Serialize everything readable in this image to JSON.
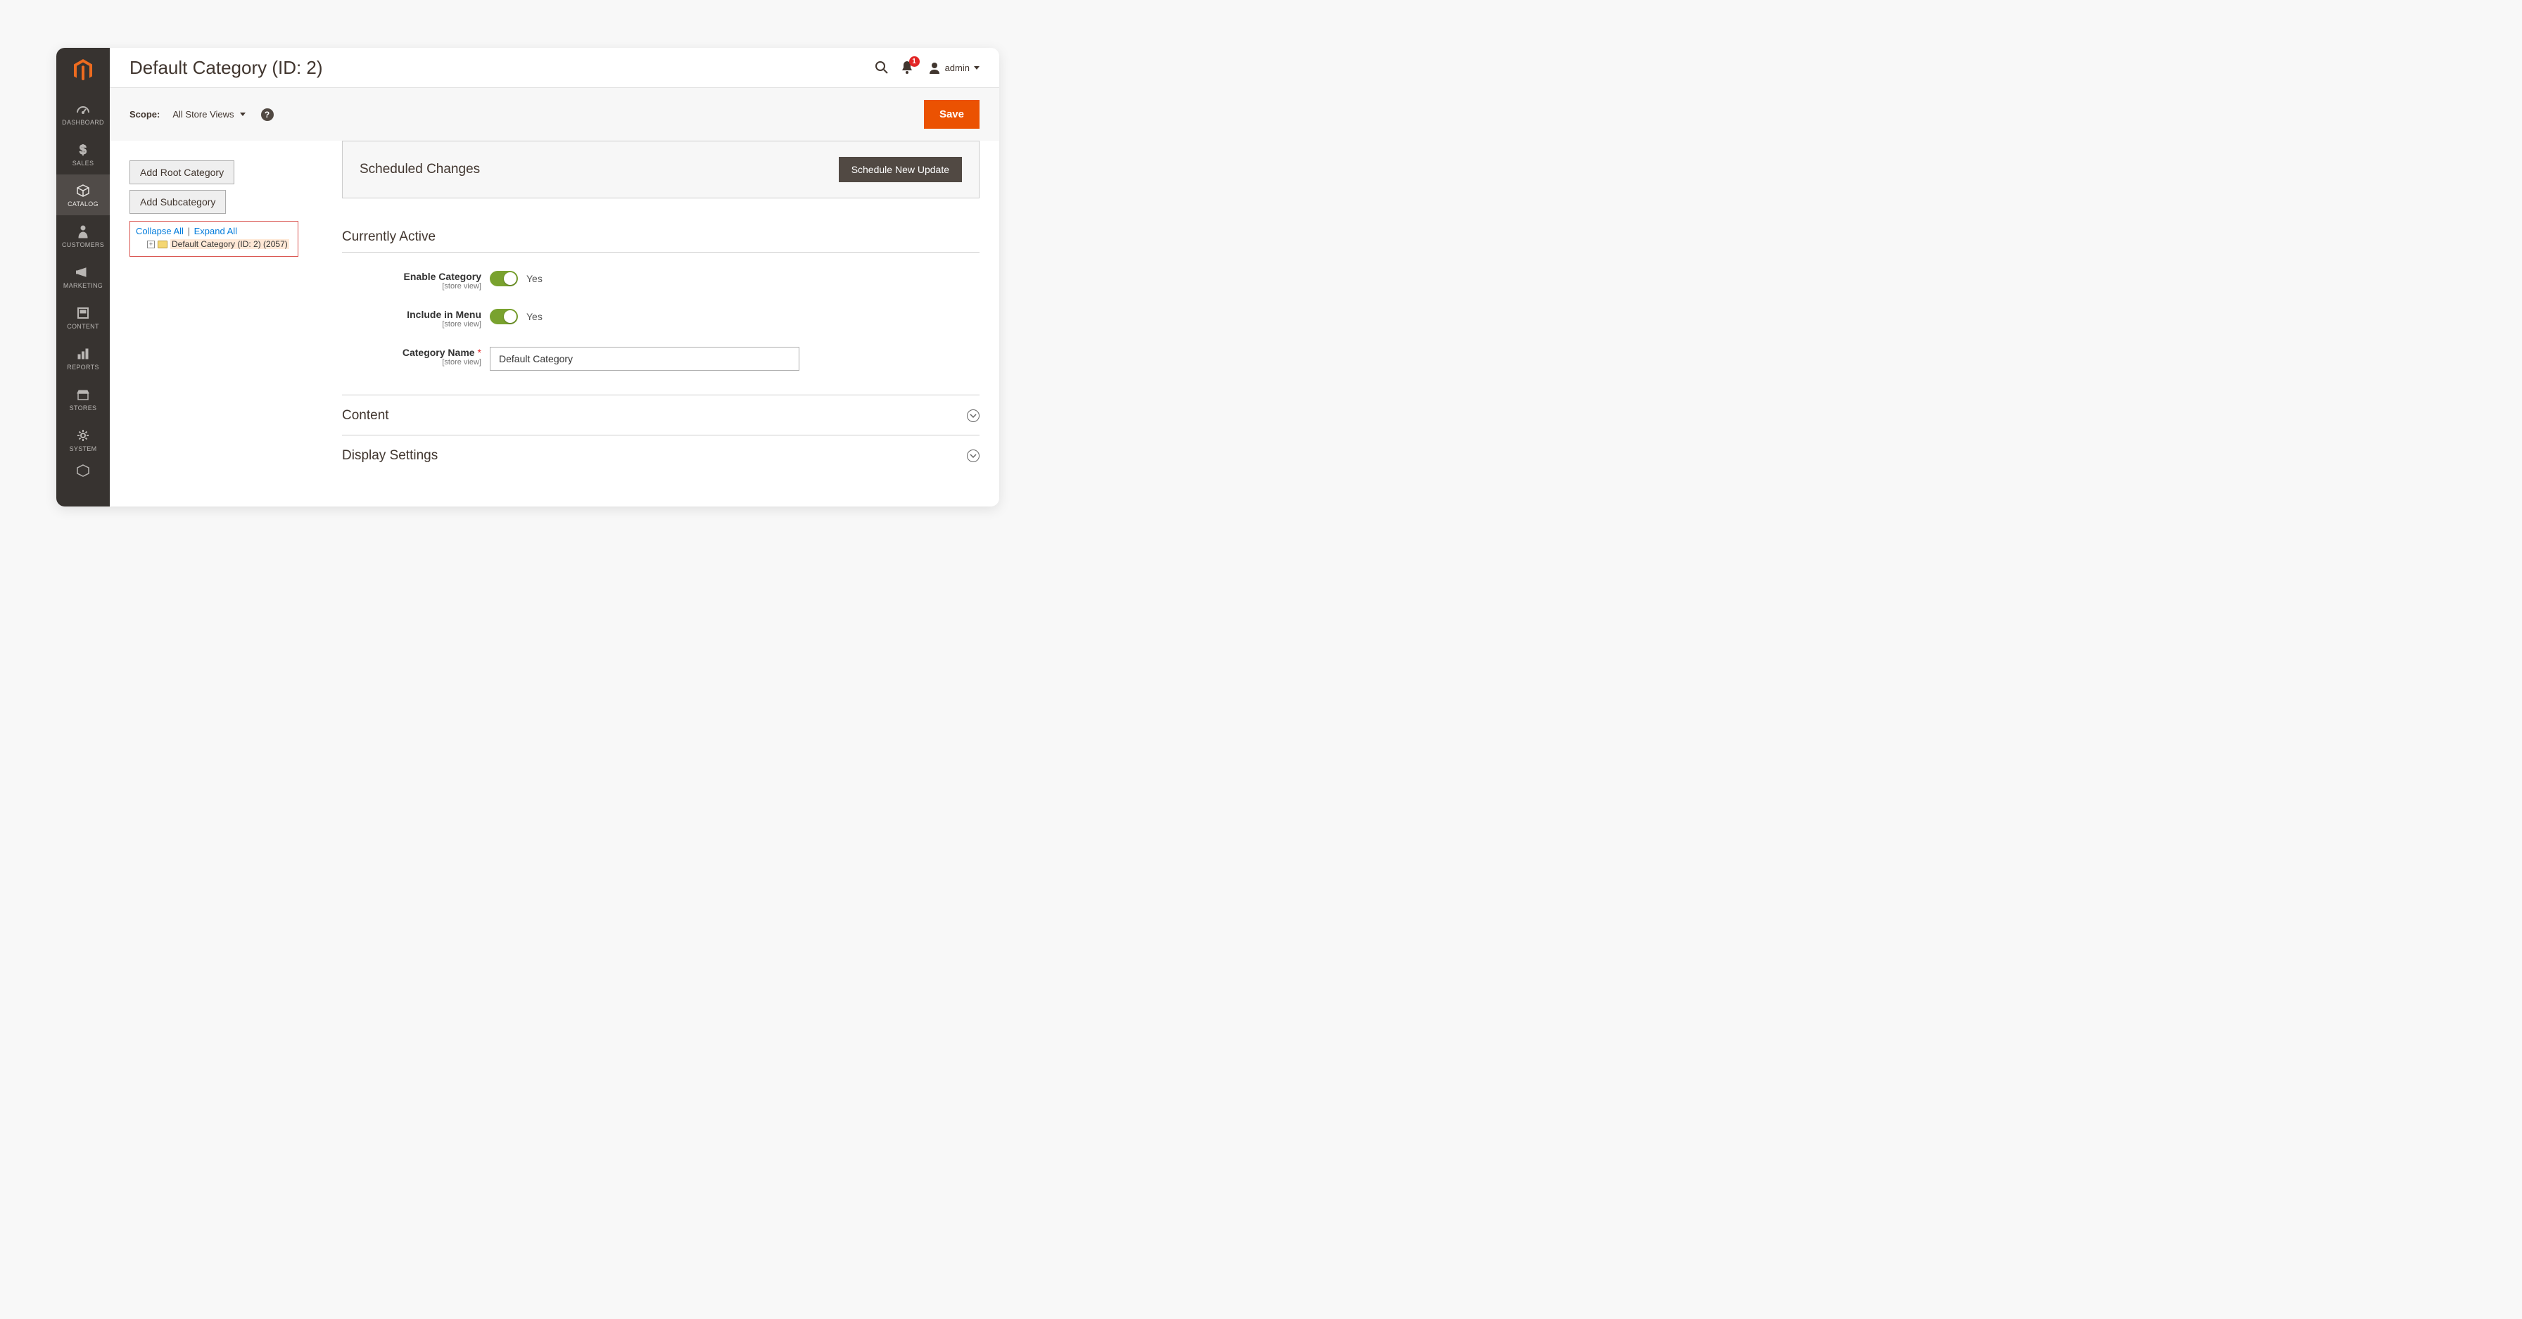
{
  "sidebar": {
    "items": [
      {
        "label": "DASHBOARD"
      },
      {
        "label": "SALES"
      },
      {
        "label": "CATALOG"
      },
      {
        "label": "CUSTOMERS"
      },
      {
        "label": "MARKETING"
      },
      {
        "label": "CONTENT"
      },
      {
        "label": "REPORTS"
      },
      {
        "label": "STORES"
      },
      {
        "label": "SYSTEM"
      }
    ]
  },
  "header": {
    "title": "Default Category (ID: 2)",
    "notification_count": "1",
    "user": "admin"
  },
  "scope": {
    "label": "Scope:",
    "value": "All Store Views",
    "save": "Save"
  },
  "tree": {
    "add_root": "Add Root Category",
    "add_sub": "Add Subcategory",
    "collapse": "Collapse All",
    "expand": "Expand All",
    "node": "Default Category (ID: 2) (2057)"
  },
  "scheduled": {
    "title": "Scheduled Changes",
    "button": "Schedule New Update"
  },
  "section_active": "Currently Active",
  "fields": {
    "enable": {
      "label": "Enable Category",
      "sub": "[store view]",
      "state": "Yes"
    },
    "include": {
      "label": "Include in Menu",
      "sub": "[store view]",
      "state": "Yes"
    },
    "name": {
      "label": "Category Name",
      "sub": "[store view]",
      "value": "Default Category"
    }
  },
  "collapsibles": {
    "content": "Content",
    "display": "Display Settings"
  }
}
